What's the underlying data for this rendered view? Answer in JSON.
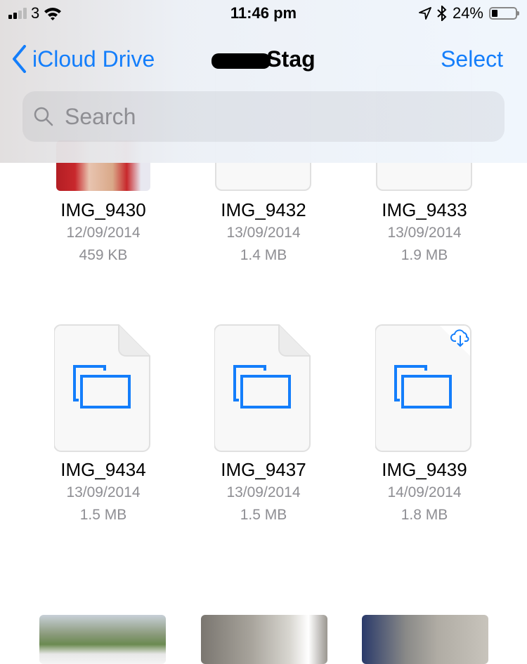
{
  "status_bar": {
    "carrier": "3",
    "time": "11:46 pm",
    "battery_percent": "24%",
    "battery_level": 0.24,
    "signal_bars": 2,
    "icons": [
      "signal-icon",
      "wifi-icon",
      "location-icon",
      "bluetooth-icon",
      "battery-icon"
    ]
  },
  "nav": {
    "back_label": "iCloud Drive",
    "title_visible": "Stag",
    "title_redacted": true,
    "select_label": "Select"
  },
  "search": {
    "placeholder": "Search"
  },
  "accent_color": "#147efb",
  "files": [
    {
      "name": "IMG_9430",
      "date": "12/09/2014",
      "size": "459 KB",
      "thumb": "photo",
      "cloud": false
    },
    {
      "name": "IMG_9432",
      "date": "13/09/2014",
      "size": "1.4 MB",
      "thumb": "document",
      "cloud": false
    },
    {
      "name": "IMG_9433",
      "date": "13/09/2014",
      "size": "1.9 MB",
      "thumb": "document",
      "cloud": false
    },
    {
      "name": "IMG_9434",
      "date": "13/09/2014",
      "size": "1.5 MB",
      "thumb": "image-document",
      "cloud": false
    },
    {
      "name": "IMG_9437",
      "date": "13/09/2014",
      "size": "1.5 MB",
      "thumb": "image-document",
      "cloud": false
    },
    {
      "name": "IMG_9439",
      "date": "14/09/2014",
      "size": "1.8 MB",
      "thumb": "image-document",
      "cloud": true
    },
    {
      "name": "",
      "date": "",
      "size": "",
      "thumb": "photo",
      "cloud": false
    },
    {
      "name": "",
      "date": "",
      "size": "",
      "thumb": "photo",
      "cloud": false
    },
    {
      "name": "",
      "date": "",
      "size": "",
      "thumb": "photo",
      "cloud": false
    }
  ]
}
